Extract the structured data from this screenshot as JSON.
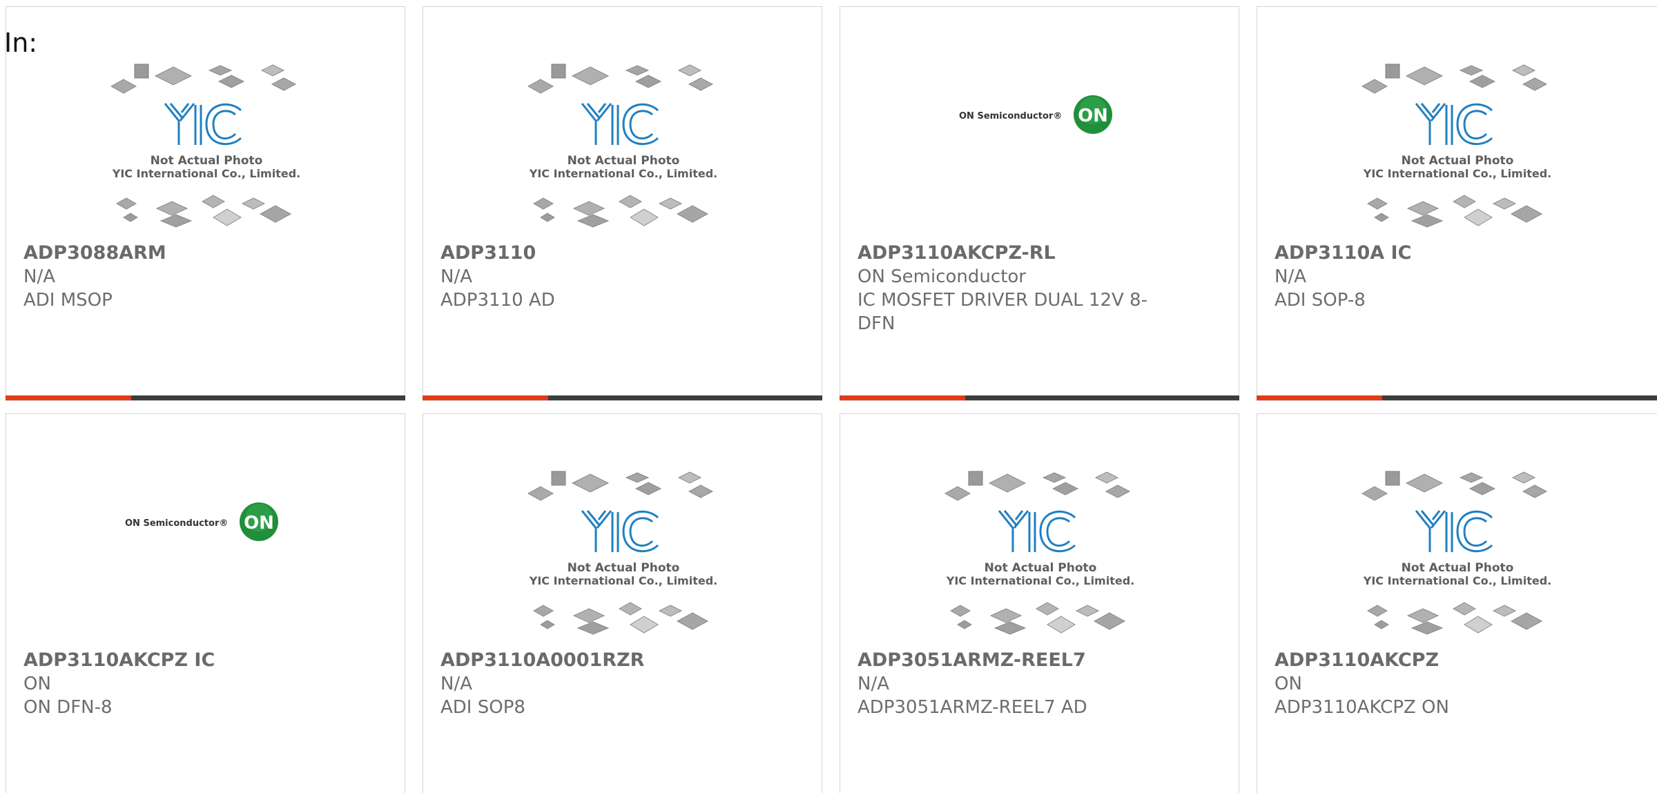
{
  "filter_label": "In:",
  "placeholder": {
    "line1": "Not Actual Photo",
    "line2": "YIC International Co., Limited."
  },
  "onsemi_logo": {
    "text": "ON Semiconductor®",
    "badge": "ON"
  },
  "products": [
    {
      "part": "ADP3088ARM",
      "brand": "N/A",
      "desc": "ADI MSOP"
    },
    {
      "part": "ADP3110",
      "brand": "N/A",
      "desc": "ADP3110 AD"
    },
    {
      "part": "ADP3110AKCPZ-RL",
      "brand": "ON Semiconductor",
      "desc": "IC MOSFET DRIVER DUAL 12V 8-DFN"
    },
    {
      "part": "ADP3110A IC",
      "brand": "N/A",
      "desc": "ADI SOP-8"
    },
    {
      "part": "ADP3110AKCPZ IC",
      "brand": "ON",
      "desc": "ON DFN-8"
    },
    {
      "part": "ADP3110A0001RZR",
      "brand": "N/A",
      "desc": "ADI SOP8"
    },
    {
      "part": "ADP3051ARMZ-REEL7",
      "brand": "N/A",
      "desc": "ADP3051ARMZ-REEL7 AD"
    },
    {
      "part": "ADP3110AKCPZ",
      "brand": "ON",
      "desc": "ADP3110AKCPZ ON"
    }
  ],
  "colors": {
    "accent": "#e23b16",
    "bar": "#3d3d3d",
    "logo_blue": "#1f7fc0",
    "onsemi_green": "#1f8f3a"
  }
}
